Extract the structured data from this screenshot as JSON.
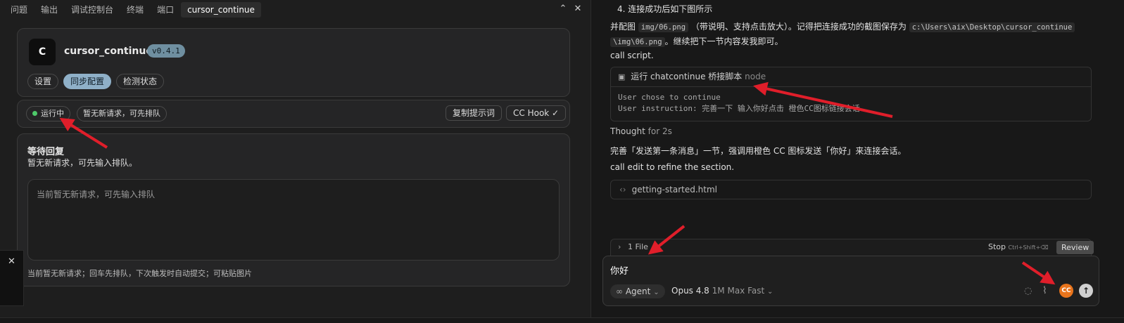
{
  "panel_tabs": [
    {
      "label": "问题"
    },
    {
      "label": "输出"
    },
    {
      "label": "调试控制台"
    },
    {
      "label": "终端"
    },
    {
      "label": "端口"
    },
    {
      "label": "cursor_continue"
    }
  ],
  "extension": {
    "logo_letter": "C",
    "name": "cursor_continue",
    "version": "v0.4.1",
    "buttons": {
      "settings": "设置",
      "sync": "同步配置",
      "detect": "检测状态"
    }
  },
  "status_row": {
    "running": "运行中",
    "queue_status": "暂无新请求，可先排队",
    "copy_prompt": "复制提示词",
    "cc_hook": "CC Hook ✓"
  },
  "waiting": {
    "title": "等待回复",
    "subtitle": "暂无新请求，可先输入排队。",
    "placeholder": "当前暂无新请求，可先输入排队",
    "hint": "当前暂无新请求；回车先排队，下次触发时自动提交；可粘贴图片"
  },
  "chat": {
    "step_heading": "4. 连接成功后如下图所示",
    "para1_a": "并配图",
    "para1_code1": "img/06.png",
    "para1_b": "（带说明、支持点击放大）。记得把连接成功的截图保存为",
    "para1_code2a": "c:\\Users\\aix\\Desktop\\cursor_continue",
    "para1_code2b": "\\img\\06.png",
    "para1_c": "。继续把下一节内容发我即可。",
    "call_script": "call script.",
    "cmd_title": "运行 chatcontinue 桥接脚本",
    "cmd_runtime": "node",
    "cmd_line1": "User chose to continue",
    "cmd_line2": "User instruction: 完善一下 输入你好点击 橙色CC图标链接会话",
    "thought": "Thought",
    "thought_time": "for 2s",
    "summary": "完善「发送第一条消息」一节，强调用橙色 CC 图标发送「你好」来连接会话。",
    "call_edit": "call edit to refine the section.",
    "edited_file": "getting-started.html",
    "files_count": "1 File",
    "stop_label": "Stop",
    "stop_shortcut": "Ctrl+Shift+⌫",
    "review_label": "Review",
    "message": "你好",
    "agent_label": "Agent",
    "model_name": "Opus 4.8",
    "model_detail": "1M Max Fast",
    "cc_button": "CC"
  },
  "colors": {
    "accent_blue": "#8fb0c8",
    "running_green": "#4ec96a",
    "cc_orange": "#e8741c",
    "arrow_red": "#e01e2a"
  }
}
